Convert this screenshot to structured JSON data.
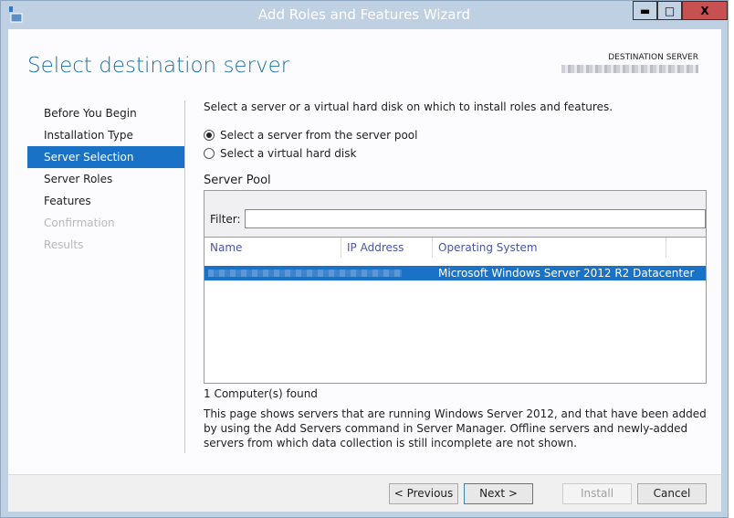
{
  "window": {
    "title": "Add Roles and Features Wizard",
    "minimize": "▬",
    "maximize": "□",
    "close": "X"
  },
  "page": {
    "heading": "Select destination server",
    "destination_label": "DESTINATION SERVER"
  },
  "nav": [
    {
      "label": "Before You Begin",
      "state": "normal"
    },
    {
      "label": "Installation Type",
      "state": "normal"
    },
    {
      "label": "Server Selection",
      "state": "selected"
    },
    {
      "label": "Server Roles",
      "state": "normal"
    },
    {
      "label": "Features",
      "state": "normal"
    },
    {
      "label": "Confirmation",
      "state": "disabled"
    },
    {
      "label": "Results",
      "state": "disabled"
    }
  ],
  "main": {
    "intro": "Select a server or a virtual hard disk on which to install roles and features.",
    "option_pool": "Select a server from the server pool",
    "option_vhd": "Select a virtual hard disk",
    "pool_title": "Server Pool",
    "filter_label": "Filter:",
    "filter_value": "",
    "columns": [
      "Name",
      "IP Address",
      "Operating System"
    ],
    "rows": [
      {
        "os": "Microsoft Windows Server 2012 R2 Datacenter"
      }
    ],
    "count": "1 Computer(s) found",
    "note": "This page shows servers that are running Windows Server 2012, and that have been added by using the Add Servers command in Server Manager. Offline servers and newly-added servers from which data collection is still incomplete are not shown."
  },
  "buttons": {
    "previous": "< Previous",
    "next": "Next >",
    "install": "Install",
    "cancel": "Cancel"
  }
}
